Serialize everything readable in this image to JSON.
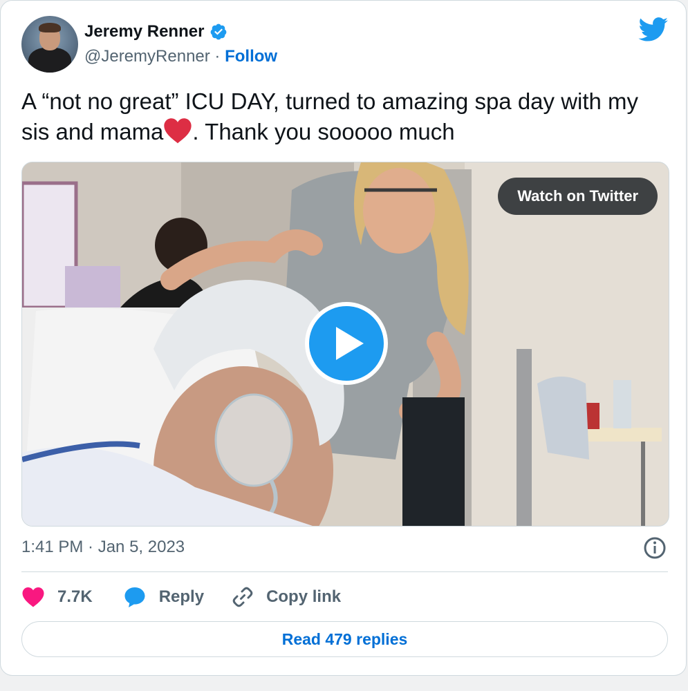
{
  "author": {
    "name": "Jeremy Renner",
    "handle": "@JeremyRenner",
    "separator": " · ",
    "follow_label": "Follow"
  },
  "tweet": {
    "text_before_emoji": "A “not no great” ICU DAY, turned to amazing spa day with my sis and mama",
    "text_after_emoji": ". Thank you sooooo much",
    "emoji": "red-heart-emoji"
  },
  "media": {
    "watch_label": "Watch on Twitter",
    "play_icon": "play-icon"
  },
  "meta": {
    "timestamp": "1:41 PM · Jan 5, 2023"
  },
  "actions": {
    "like_count": "7.7K",
    "reply_label": "Reply",
    "copy_label": "Copy link",
    "read_replies_label": "Read 479 replies"
  },
  "colors": {
    "accent": "#1d9bf0",
    "link": "#006fd6",
    "like": "#f91880",
    "muted": "#536471"
  }
}
